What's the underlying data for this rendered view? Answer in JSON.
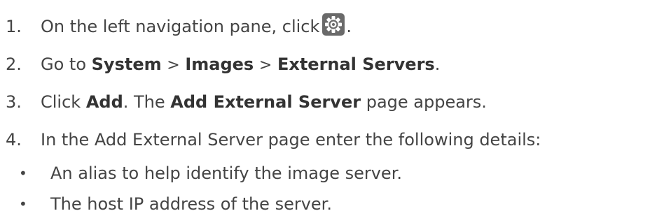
{
  "steps": [
    {
      "num": "1.",
      "text_before_icon": "On the left navigation pane, click",
      "icon": "gear-icon",
      "text_after_icon": "."
    },
    {
      "num": "2.",
      "prefix": "Go to ",
      "path": [
        "System",
        "Images",
        "External Servers"
      ],
      "separator": ">",
      "suffix": "."
    },
    {
      "num": "3.",
      "t1": "Click ",
      "b1": "Add",
      "t2": ". The ",
      "b2": "Add External Server",
      "t3": " page appears."
    },
    {
      "num": "4.",
      "text": "In the Add External Server page enter the following details:"
    }
  ],
  "bullets": [
    {
      "mark": "•",
      "text": "An alias to help identify the image server."
    },
    {
      "mark": "•",
      "text": "The host IP address of the server."
    }
  ],
  "colors": {
    "text": "#444444",
    "icon_bg": "#6a6a6a"
  }
}
